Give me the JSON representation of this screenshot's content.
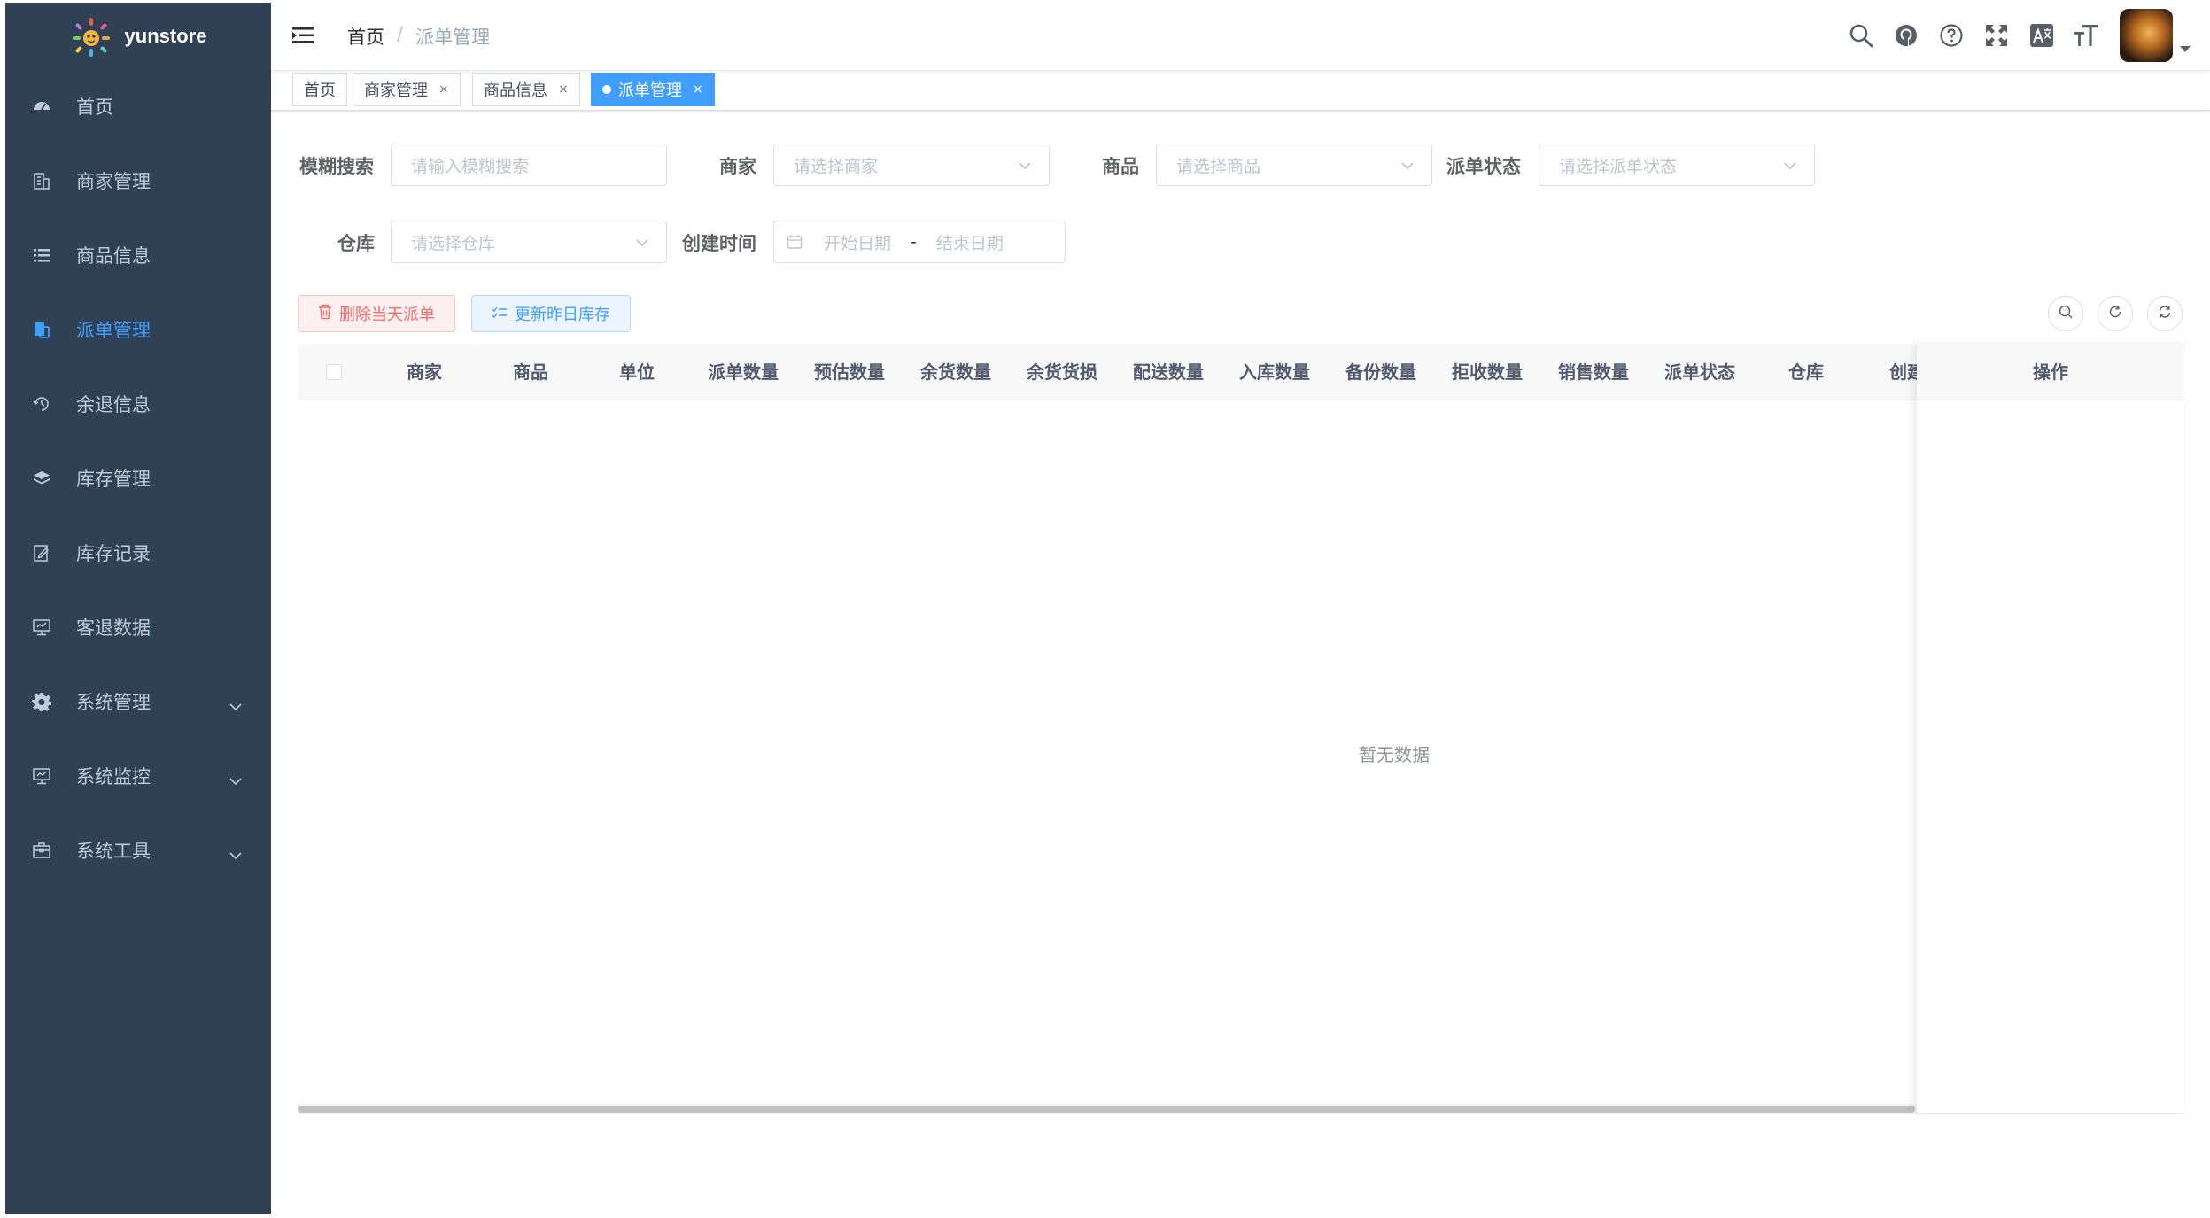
{
  "app": {
    "name": "yunstore"
  },
  "sidebar": {
    "items": [
      {
        "label": "首页",
        "icon": "dashboard-icon"
      },
      {
        "label": "商家管理",
        "icon": "building-icon"
      },
      {
        "label": "商品信息",
        "icon": "list-icon"
      },
      {
        "label": "派单管理",
        "icon": "dispatch-icon",
        "active": true
      },
      {
        "label": "余退信息",
        "icon": "return-icon"
      },
      {
        "label": "库存管理",
        "icon": "layers-icon"
      },
      {
        "label": "库存记录",
        "icon": "edit-icon"
      },
      {
        "label": "客退数据",
        "icon": "monitor-icon"
      },
      {
        "label": "系统管理",
        "icon": "gear-icon",
        "expandable": true
      },
      {
        "label": "系统监控",
        "icon": "monitor-icon",
        "expandable": true
      },
      {
        "label": "系统工具",
        "icon": "toolbox-icon",
        "expandable": true
      }
    ]
  },
  "breadcrumb": {
    "home": "首页",
    "separator": "/",
    "current": "派单管理"
  },
  "tags": [
    {
      "label": "首页",
      "closable": false
    },
    {
      "label": "商家管理",
      "closable": true
    },
    {
      "label": "商品信息",
      "closable": true
    },
    {
      "label": "派单管理",
      "closable": true,
      "active": true
    }
  ],
  "tag_close": "×",
  "filters": {
    "fuzzy": {
      "label": "模糊搜索",
      "placeholder": "请输入模糊搜索"
    },
    "merchant": {
      "label": "商家",
      "placeholder": "请选择商家"
    },
    "product": {
      "label": "商品",
      "placeholder": "请选择商品"
    },
    "status": {
      "label": "派单状态",
      "placeholder": "请选择派单状态"
    },
    "warehouse": {
      "label": "仓库",
      "placeholder": "请选择仓库"
    },
    "created": {
      "label": "创建时间",
      "start_placeholder": "开始日期",
      "separator": "-",
      "end_placeholder": "结束日期"
    }
  },
  "actions": {
    "delete_today": "删除当天派单",
    "update_yesterday": "更新昨日库存"
  },
  "table": {
    "columns": [
      "商家",
      "商品",
      "单位",
      "派单数量",
      "预估数量",
      "余货数量",
      "余货货损",
      "配送数量",
      "入库数量",
      "备份数量",
      "拒收数量",
      "销售数量",
      "派单状态",
      "仓库",
      "创建"
    ],
    "fixed_column": "操作",
    "empty_text": "暂无数据"
  },
  "colors": {
    "sidebar_bg": "#304156",
    "accent": "#409eff",
    "danger": "#f56c6c"
  }
}
